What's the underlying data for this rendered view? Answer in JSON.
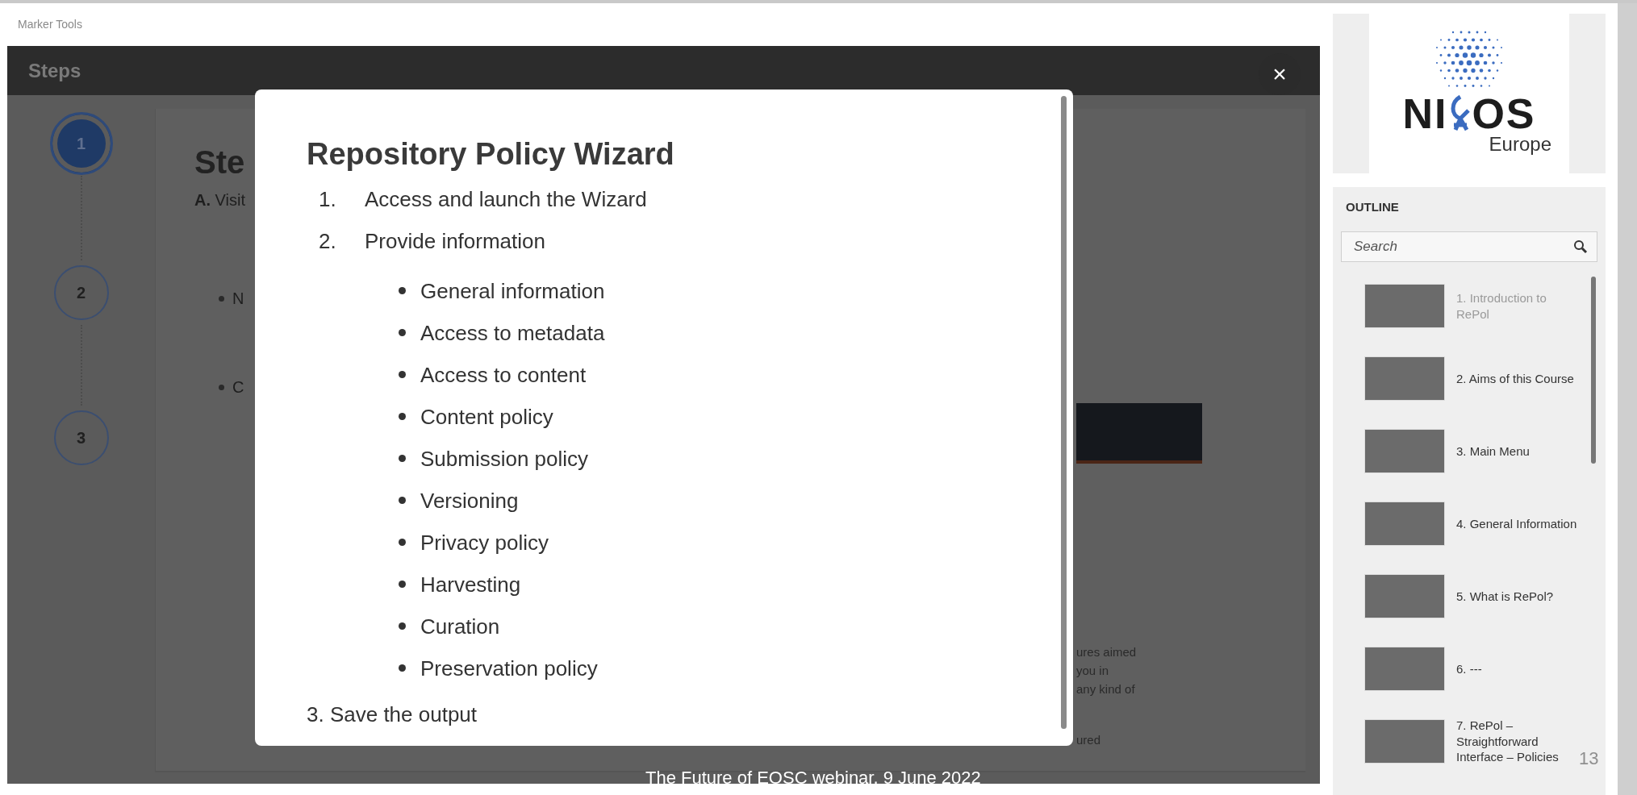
{
  "toolbar": {
    "title": "Marker Tools"
  },
  "steps_panel": {
    "title": "Steps",
    "steps": [
      {
        "label": "1",
        "selected": true
      },
      {
        "label": "2",
        "selected": false
      },
      {
        "label": "3",
        "selected": false
      }
    ],
    "content": {
      "heading": "Ste",
      "intro": "**A.** Visit",
      "bullets": [
        "N",
        "C"
      ],
      "fragments": [
        "ures aimed",
        "you in",
        "any kind of",
        "ured"
      ]
    }
  },
  "modal": {
    "title": "Repository Policy Wizard",
    "items": [
      {
        "number": "1.",
        "text": "Access and launch the Wizard"
      },
      {
        "number": "2.",
        "text": "Provide information",
        "children": [
          "General information",
          "Access to metadata",
          "Access to content",
          "Content policy",
          "Submission policy",
          "Versioning",
          "Privacy policy",
          "Harvesting",
          "Curation",
          "Preservation policy"
        ]
      }
    ],
    "closing": "3. Save the output",
    "close_label": "×"
  },
  "slide_caption": "The Future of EOSC webinar, 9 June 2022",
  "slide_number": "13",
  "sidebar": {
    "logo": {
      "left": "NI",
      "right": "OS",
      "subtitle": "Europe"
    },
    "outline_title": "OUTLINE",
    "search": {
      "placeholder": "Search"
    },
    "items": [
      {
        "title": "1. Introduction to RePol",
        "disabled": true
      },
      {
        "title": "2. Aims of this Course",
        "disabled": false
      },
      {
        "title": "3. Main Menu",
        "disabled": false
      },
      {
        "title": "4. General Information",
        "disabled": false
      },
      {
        "title": "5. What is RePol?",
        "disabled": false
      },
      {
        "title": "6. ---",
        "disabled": false
      },
      {
        "title": "7. RePol – Straightforward Interface – Policies",
        "disabled": false
      }
    ]
  }
}
